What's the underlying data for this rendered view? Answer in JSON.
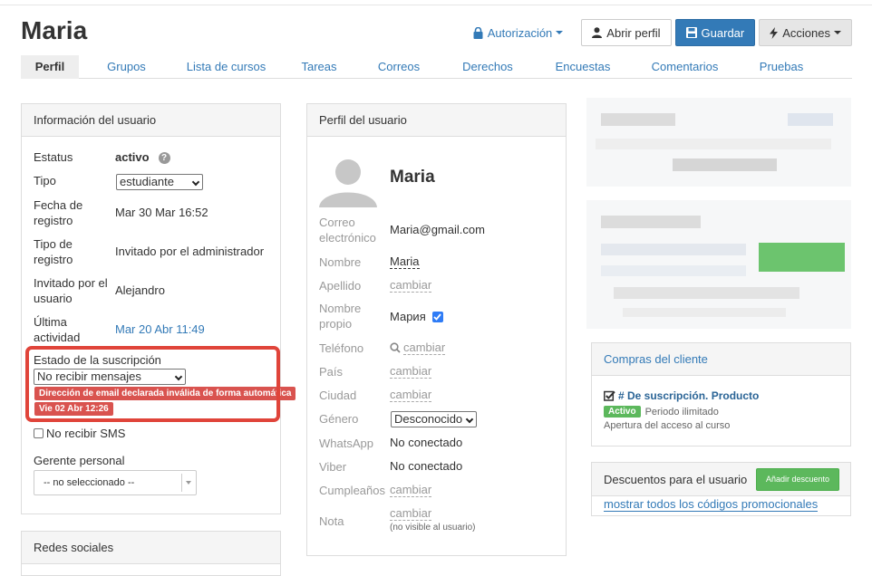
{
  "header": {
    "title": "Maria",
    "auth_label": "Autorización",
    "open_profile_label": "Abrir perfil",
    "save_label": "Guardar",
    "actions_label": "Acciones"
  },
  "tabs": [
    "Perfil",
    "Grupos",
    "Lista de cursos",
    "Tareas",
    "Correos",
    "Derechos",
    "Encuestas",
    "Comentarios",
    "Pruebas"
  ],
  "user_info": {
    "title": "Información del usuario",
    "status_label": "Estatus",
    "status_value": "activo",
    "type_label": "Tipo",
    "type_value": "estudiante",
    "reg_date_label": "Fecha de registro",
    "reg_date_value": "Mar 30 Mar 16:52",
    "reg_type_label": "Tipo de registro",
    "reg_type_value": "Invitado por el administrador",
    "invited_by_label": "Invitado por el usuario",
    "invited_by_value": "Alejandro",
    "last_activity_label": "Última actividad",
    "last_activity_value": "Mar 20 Abr 11:49",
    "subscription_label": "Estado de la suscripción",
    "subscription_value": "No recibir mensajes",
    "warning_badge": "Dirección de email declarada inválida de forma automática",
    "date_badge": "Vie 02 Abr 12:26",
    "no_sms_label": "No recibir SMS",
    "manager_label": "Gerente personal",
    "manager_value": "-- no seleccionado --"
  },
  "social": {
    "title": "Redes sociales"
  },
  "profile": {
    "title": "Perfil del usuario",
    "name": "Maria",
    "email_label": "Correo electrónico",
    "email_value": "Maria@gmail.com",
    "first_name_label": "Nombre",
    "first_name_value": "Maria",
    "last_name_label": "Apellido",
    "own_name_label": "Nombre propio",
    "own_name_value": "Мария",
    "phone_label": "Teléfono",
    "country_label": "País",
    "city_label": "Ciudad",
    "gender_label": "Género",
    "gender_value": "Desconocido",
    "whatsapp_label": "WhatsApp",
    "whatsapp_value": "No conectado",
    "viber_label": "Viber",
    "viber_value": "No conectado",
    "birthday_label": "Cumpleaños",
    "note_label": "Nota",
    "change_link": "cambiar",
    "note_hint": "(no visible al usuario)"
  },
  "purchases": {
    "title": "Compras del cliente",
    "item_title": "# De suscripción. Producto",
    "status_badge": "Activo",
    "period": "Periodo ilimitado",
    "description": "Apertura del acceso al curso"
  },
  "discounts": {
    "title": "Descuentos para el usuario",
    "add_button": "Añadir descuento",
    "show_all_link": "mostrar todos los códigos promocionales"
  },
  "colors": {
    "link": "#337ab7",
    "primary": "#337ab7",
    "danger": "#d9534f",
    "highlight_border": "#e0443a",
    "success": "#5cb85c"
  }
}
